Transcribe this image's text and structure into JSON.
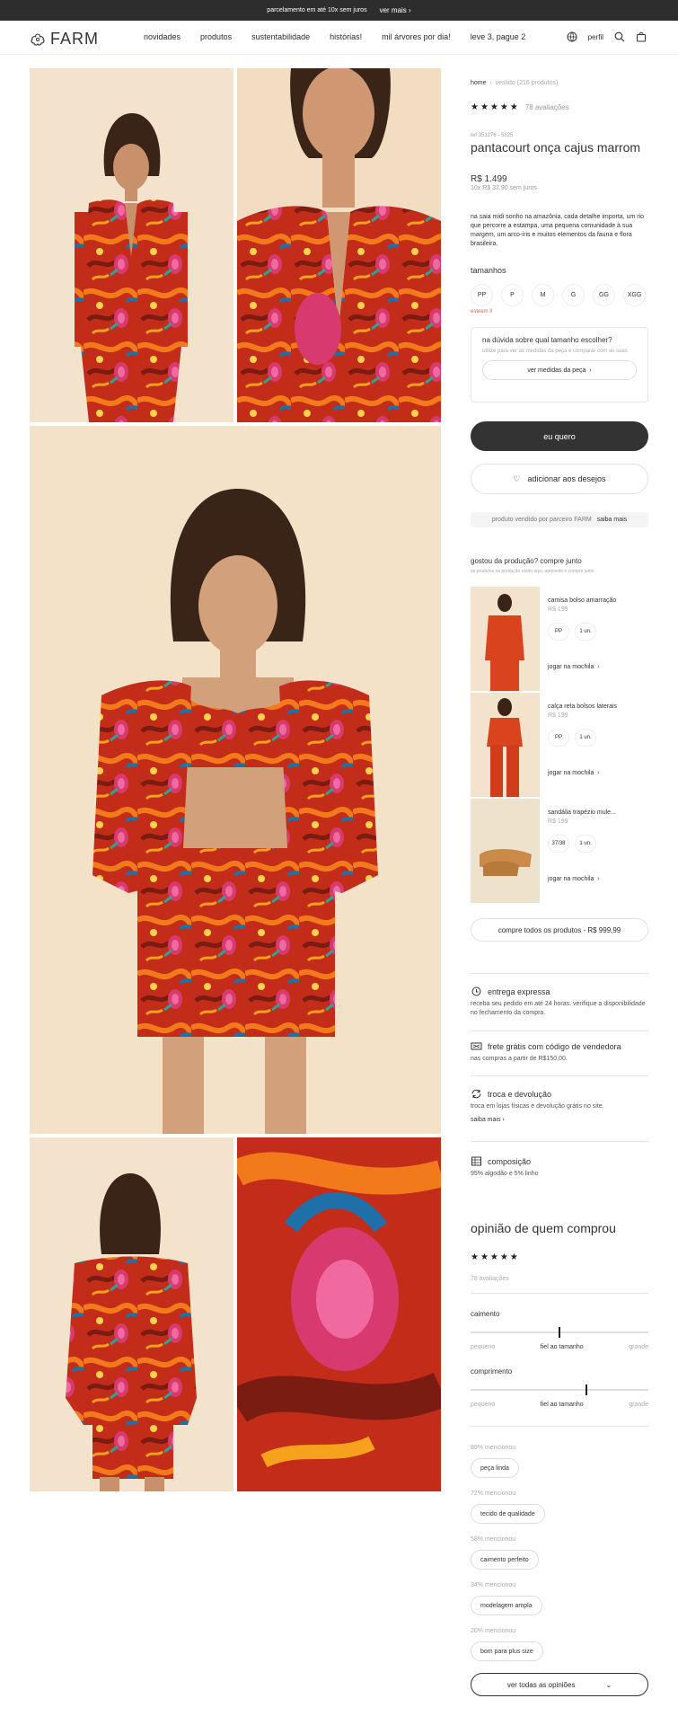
{
  "announcement": {
    "text": "parcelamento em até 10x sem juros",
    "link": "ver mais"
  },
  "header": {
    "logo": "FARM",
    "nav": [
      "novidades",
      "produtos",
      "sustentabilidade",
      "histórias!",
      "mil árvores por dia!",
      "leve 3, pague 2"
    ],
    "profile": "perfil"
  },
  "breadcrumb": {
    "home": "home",
    "current": "vestido (216 produtos)"
  },
  "product": {
    "stars": "★★★★★",
    "reviews_count": "78 avaliações",
    "ref": "ref 351276 - 5325",
    "title": "pantacourt onça cajus marrom",
    "price": "R$ 1.499",
    "installments": "10x R$ 32,90 sem juros",
    "description": "na saia midi sonho na amazônia, cada detalhe importa, um rio que percorre a estampa, uma pequena comunidade à sua margem, um arco-íris e muitos elementos da fauna e flora brasileira.",
    "sizes_label": "tamanhos",
    "sizes": [
      "PP",
      "P",
      "M",
      "G",
      "GG",
      "XGG"
    ],
    "sizes_hint": "esteem ll",
    "size_help": {
      "question": "na dúvida sobre qual tamanho escolher?",
      "sub": "utilize para ver as medidas da peça e comparar com as suas",
      "button": "ver medidas da peça"
    },
    "buy_label": "eu quero",
    "wishlist_label": "adicionar aos desejos",
    "partner_text": "produto vendido por parceiro FARM",
    "partner_link": "saiba mais"
  },
  "complete_look": {
    "title": "gostou da produção? compre junto",
    "subtitle": "os produtos na produção estão aqui, aproveite e compre junto",
    "items": [
      {
        "name": "camisa bolso amarração",
        "price": "R$ 199",
        "size": "PP",
        "qty": "1 un.",
        "add": "jogar na mochila"
      },
      {
        "name": "calça reta bolsos laterais",
        "price": "R$ 199",
        "size": "PP",
        "qty": "1 un.",
        "add": "jogar na mochila"
      },
      {
        "name": "sandália trapézio mule...",
        "price": "R$ 199",
        "size": "37/38",
        "qty": "1 un.",
        "add": "jogar na mochila"
      }
    ],
    "buy_all": "compre todos os produtos - R$ 999,99"
  },
  "info": {
    "express": {
      "title": "entrega expressa",
      "desc": "receba seu pedido em até 24 horas. verifique a disponibilidade no fechamento da compra."
    },
    "shipping": {
      "title": "frete grátis com código de vendedora",
      "desc": "nas compras a partir de R$150,00."
    },
    "returns": {
      "title": "troca e devolução",
      "desc": "troca em lojas físicas e devolução grátis no site.",
      "more": "saiba mais"
    },
    "composition": {
      "title": "composição",
      "desc": "95% algodão e 5% linho"
    }
  },
  "reviews": {
    "title": "opinião de quem comprou",
    "stars": "★★★★★",
    "count": "78 avaliações",
    "fit": {
      "label": "caimento",
      "left": "pequeno",
      "mid": "fiel ao tamanho",
      "right": "grande",
      "level": 0.5
    },
    "length": {
      "label": "comprimento",
      "left": "pequeno",
      "mid": "fiel ao tamanho",
      "right": "grande",
      "level": 0.65
    },
    "tags": [
      {
        "pct": "89% mencionou",
        "tag": "peça linda"
      },
      {
        "pct": "72% mencionou",
        "tag": "tecido de qualidade"
      },
      {
        "pct": "58% mencionou",
        "tag": "caimento perfeito"
      },
      {
        "pct": "34% mencionou",
        "tag": "modelagem ampla"
      },
      {
        "pct": "20% mencionou",
        "tag": "bom para plus size"
      }
    ],
    "all_label": "ver todas as opiniões"
  },
  "colors": {
    "dark": "#2d2d2d",
    "bg_photo": "#f3e3cd",
    "print_red": "#d4331c",
    "print_orange": "#f17a1a",
    "print_pink": "#d8396e",
    "print_blue": "#1f6fa8"
  }
}
